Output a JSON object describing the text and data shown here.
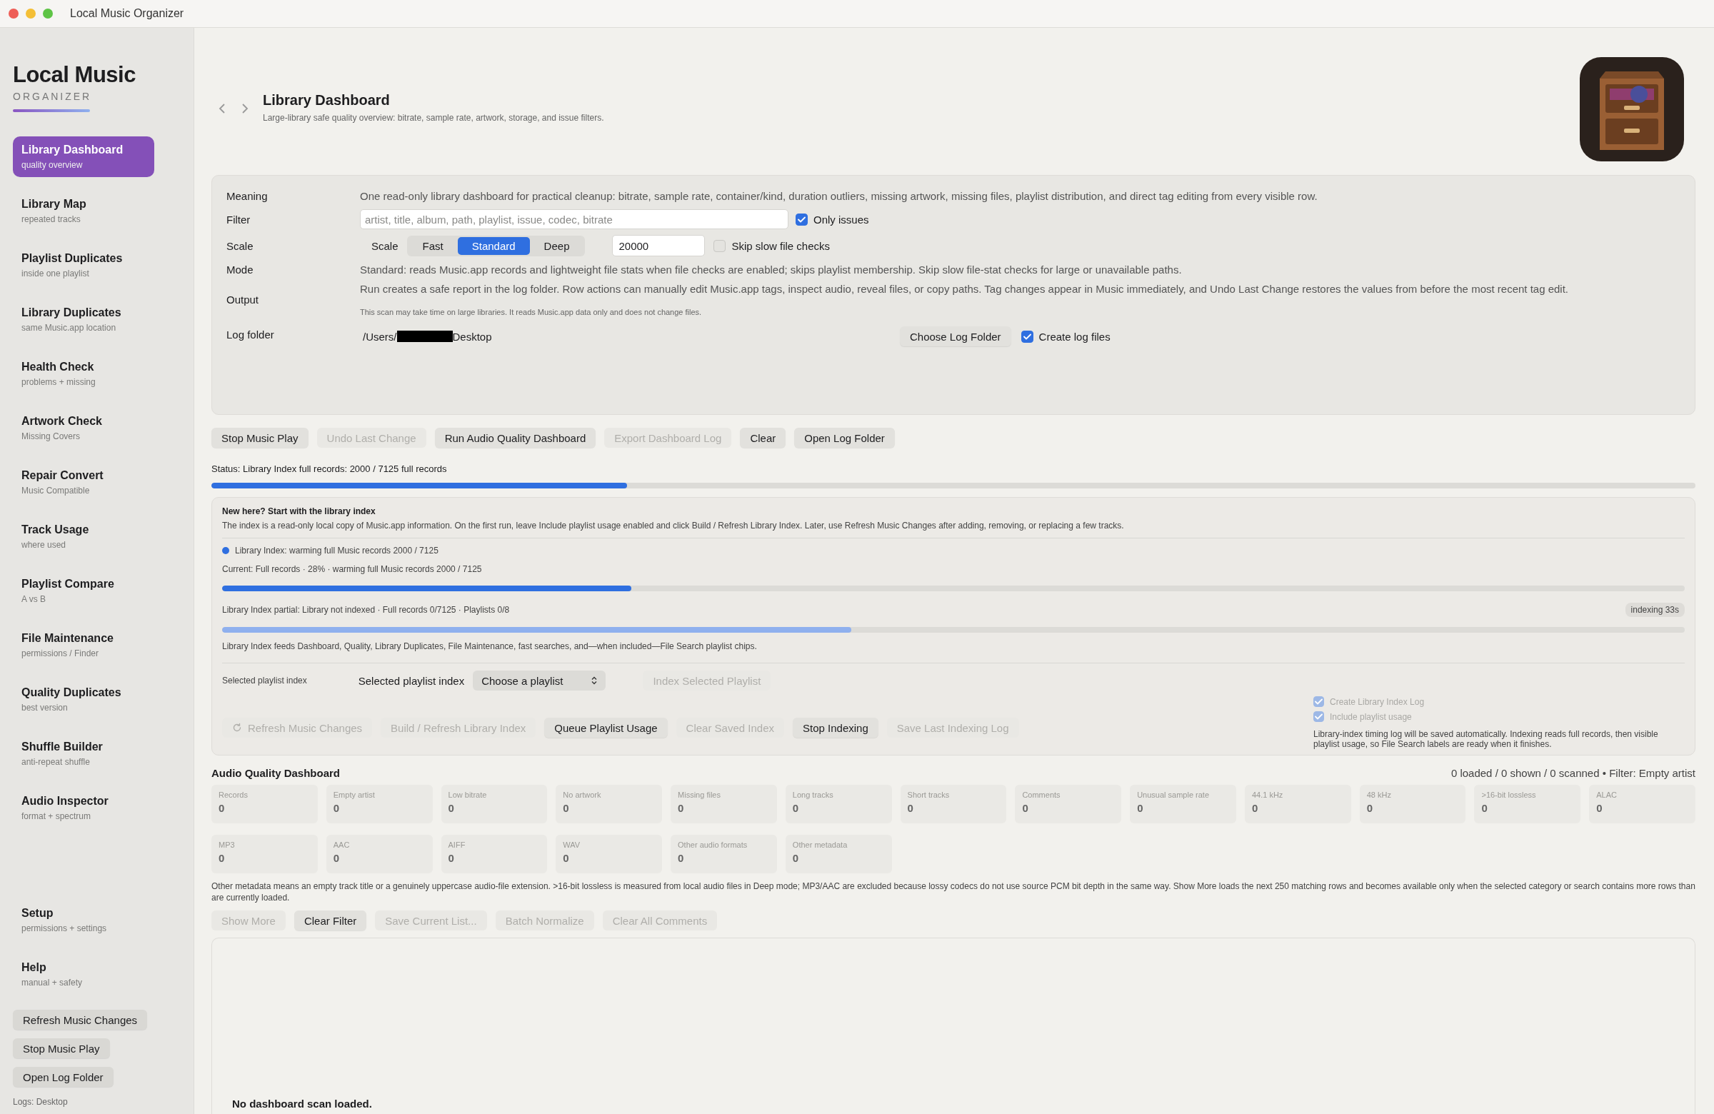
{
  "window": {
    "title": "Local Music Organizer"
  },
  "sidebar": {
    "brand": "Local Music",
    "brand_sub": "ORGANIZER",
    "items": [
      {
        "title": "Library Dashboard",
        "subtitle": "quality overview",
        "selected": true
      },
      {
        "title": "Library Map",
        "subtitle": "repeated tracks",
        "selected": false
      },
      {
        "title": "Playlist Duplicates",
        "subtitle": "inside one playlist",
        "selected": false
      },
      {
        "title": "Library Duplicates",
        "subtitle": "same Music.app location",
        "selected": false
      },
      {
        "title": "Health Check",
        "subtitle": "problems + missing",
        "selected": false
      },
      {
        "title": "Artwork Check",
        "subtitle": "Missing Covers",
        "selected": false
      },
      {
        "title": "Repair Convert",
        "subtitle": "Music Compatible",
        "selected": false
      },
      {
        "title": "Track Usage",
        "subtitle": "where used",
        "selected": false
      },
      {
        "title": "Playlist Compare",
        "subtitle": "A vs B",
        "selected": false
      },
      {
        "title": "File Maintenance",
        "subtitle": "permissions / Finder",
        "selected": false
      },
      {
        "title": "Quality Duplicates",
        "subtitle": "best version",
        "selected": false
      },
      {
        "title": "Shuffle Builder",
        "subtitle": "anti-repeat shuffle",
        "selected": false
      },
      {
        "title": "Audio Inspector",
        "subtitle": "format + spectrum",
        "selected": false
      }
    ],
    "bottom_items": [
      {
        "title": "Setup",
        "subtitle": "permissions + settings",
        "selected": false
      },
      {
        "title": "Help",
        "subtitle": "manual + safety",
        "selected": false
      }
    ],
    "buttons": [
      "Refresh Music Changes",
      "Stop Music Play",
      "Open Log Folder"
    ],
    "logs": "Logs: Desktop"
  },
  "header": {
    "title": "Library Dashboard",
    "subtitle": "Large-library safe quality overview: bitrate, sample rate, artwork, storage, and issue filters."
  },
  "settings": [
    {
      "kind": "text",
      "label": "Meaning",
      "text": "One read-only library dashboard for practical cleanup: bitrate, sample rate, container/kind, duration outliers, missing artwork, missing files, playlist distribution, and direct tag editing from every visible row."
    },
    {
      "kind": "filter",
      "label": "Filter",
      "placeholder": "artist, title, album, path, playlist, issue, codec, bitrate",
      "checkbox": {
        "label": "Only issues",
        "checked": true
      }
    },
    {
      "kind": "scale",
      "label": "Scale",
      "segment_label": "Scale",
      "segments": [
        {
          "label": "Fast",
          "selected": false
        },
        {
          "label": "Standard",
          "selected": true
        },
        {
          "label": "Deep",
          "selected": false
        }
      ],
      "value": "20000",
      "checkbox": {
        "label": "Skip slow file checks",
        "checked": false
      }
    },
    {
      "kind": "text",
      "label": "Mode",
      "text": "Standard: reads Music.app records and lightweight file stats when file checks are enabled; skips playlist membership. Skip slow file-stat checks for large or unavailable paths."
    },
    {
      "kind": "text",
      "label": "Output",
      "text": "Run creates a safe report in the log folder. Row actions can manually edit Music.app tags, inspect audio, reveal files, or copy paths. Tag changes appear in Music immediately, and Undo Last Change restores the values from before the most recent tag edit.",
      "note": "This scan may take time on large libraries. It reads Music.app data only and does not change files."
    },
    {
      "kind": "folder",
      "label": "Log folder",
      "path_start": "/Users/",
      "path_end": "Desktop",
      "button": "Choose Log Folder",
      "checkbox": {
        "label": "Create log files",
        "checked": true
      }
    }
  ],
  "actions": [
    {
      "label": "Stop Music Play",
      "disabled": false
    },
    {
      "label": "Undo Last Change",
      "disabled": true
    },
    {
      "label": "Run Audio Quality Dashboard",
      "disabled": false
    },
    {
      "label": "Export Dashboard Log",
      "disabled": true
    },
    {
      "label": "Clear",
      "disabled": false
    },
    {
      "label": "Open Log Folder",
      "disabled": false
    }
  ],
  "status": {
    "text": "Status: Library Index full records: 2000 / 7125 full records",
    "level": 0.28
  },
  "index_panel": {
    "title": "New here? Start with the library index",
    "description": "The index is a read-only local copy of Music.app information. On the first run, leave Include playlist usage enabled and click Build / Refresh Library Index. Later, use Refresh Music Changes after adding, removing, or replacing a few tracks.",
    "status_line": "Library Index: warming full Music records 2000 / 7125",
    "current": {
      "text": "Current: Full records · 28% · warming full Music records 2000 / 7125",
      "level": 0.28
    },
    "partial": {
      "text": "Library Index partial: Library not indexed · Full records 0/7125 · Playlists 0/8",
      "badge": "indexing 33s",
      "level": 0.43
    },
    "feeds": "Library Index feeds Dashboard, Quality, Library Duplicates, File Maintenance, fast searches, and—when included—File Search playlist chips.",
    "playlist_caption": "Selected playlist index",
    "playlist_label": "Selected playlist index",
    "playlist_select": "Choose a playlist",
    "playlist_button": {
      "label": "Index Selected Playlist",
      "disabled": true
    },
    "buttons": [
      {
        "kind": "refresh",
        "label": "Refresh Music Changes",
        "disabled": true
      },
      {
        "kind": "plain",
        "label": "Build / Refresh Library Index",
        "disabled": true
      },
      {
        "kind": "plain",
        "label": "Queue Playlist Usage",
        "disabled": false
      },
      {
        "kind": "plain",
        "label": "Clear Saved Index",
        "disabled": true
      },
      {
        "kind": "plain",
        "label": "Stop Indexing",
        "disabled": false
      },
      {
        "kind": "plain",
        "label": "Save Last Indexing Log",
        "disabled": true
      }
    ],
    "checkboxes": [
      {
        "label": "Create Library Index Log",
        "checked": true,
        "disabled": true
      },
      {
        "label": "Include playlist usage",
        "checked": true,
        "disabled": true
      }
    ],
    "note": "Library-index timing log will be saved automatically. Indexing reads full records, then visible playlist usage, so File Search labels are ready when it finishes."
  },
  "quality": {
    "title": "Audio Quality Dashboard",
    "summary": "0 loaded / 0 shown / 0 scanned • Filter: Empty artist",
    "stats": [
      [
        {
          "label": "Records",
          "value": "0"
        },
        {
          "label": "Empty artist",
          "value": "0"
        },
        {
          "label": "Low bitrate",
          "value": "0"
        },
        {
          "label": "No artwork",
          "value": "0"
        },
        {
          "label": "Missing files",
          "value": "0"
        },
        {
          "label": "Long tracks",
          "value": "0"
        },
        {
          "label": "Short tracks",
          "value": "0"
        },
        {
          "label": "Comments",
          "value": "0"
        },
        {
          "label": "Unusual sample rate",
          "value": "0"
        },
        {
          "label": "44.1 kHz",
          "value": "0"
        },
        {
          "label": "48 kHz",
          "value": "0"
        },
        {
          "label": ">16-bit lossless",
          "value": "0"
        },
        {
          "label": "ALAC",
          "value": "0"
        }
      ],
      [
        {
          "label": "MP3",
          "value": "0"
        },
        {
          "label": "AAC",
          "value": "0"
        },
        {
          "label": "AIFF",
          "value": "0"
        },
        {
          "label": "WAV",
          "value": "0"
        },
        {
          "label": "Other audio formats",
          "value": "0"
        },
        {
          "label": "Other metadata",
          "value": "0"
        }
      ]
    ],
    "note": "Other metadata means an empty track title or a genuinely uppercase audio-file extension. >16-bit lossless is measured from local audio files in Deep mode; MP3/AAC are excluded because lossy codecs do not use source PCM bit depth in the same way. Show More loads the next 250 matching rows and becomes available only when the selected category or search contains more rows than are currently loaded.",
    "buttons": [
      {
        "label": "Show More",
        "disabled": true
      },
      {
        "label": "Clear Filter",
        "disabled": false
      },
      {
        "label": "Save Current List...",
        "disabled": true
      },
      {
        "label": "Batch Normalize",
        "disabled": true
      },
      {
        "label": "Clear All Comments",
        "disabled": true
      }
    ],
    "empty_title": "No dashboard scan loaded."
  }
}
